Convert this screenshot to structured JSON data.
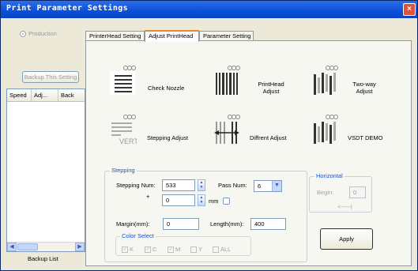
{
  "window": {
    "title": "Print Parameter Settings",
    "close": "×"
  },
  "left": {
    "radio_label": "Production",
    "backup_button": "Backup This Setting",
    "columns": [
      "Speed",
      "Adj...",
      "Back"
    ],
    "footer": "Backup List"
  },
  "tabs": [
    {
      "label": "PrinterHead Setting"
    },
    {
      "label": "Adjust PrintHead"
    },
    {
      "label": "Parameter Setting"
    }
  ],
  "tools": [
    {
      "label": "Check Nozzle"
    },
    {
      "label": "PrintHead Adjust"
    },
    {
      "label": "Two-way Adjust"
    },
    {
      "label": "Stepping Adjust"
    },
    {
      "label": "Diffrent Adjust"
    },
    {
      "label": "VSDT DEMO"
    }
  ],
  "stepping": {
    "title": "Stepping",
    "stepping_num_label": "Stepping Num:",
    "stepping_num": "533",
    "plus_label": "+",
    "offset": "0",
    "mm_label": "mm",
    "pass_num_label": "Pass Num:",
    "pass_num": "6",
    "margin_label": "Margin(mm):",
    "margin": "0",
    "length_label": "Length(mm):",
    "length": "400",
    "color_title": "Color Select",
    "colors": [
      "K",
      "C",
      "M",
      "Y",
      "ALL"
    ]
  },
  "horizontal": {
    "title": "Horizontal",
    "begin_label": "Begin:",
    "begin": "0",
    "arrow": "<-----|"
  },
  "apply_label": "Apply"
}
